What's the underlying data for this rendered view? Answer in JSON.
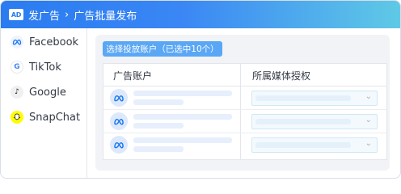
{
  "titlebar": {
    "badge": "AD",
    "crumb_root": "发广告",
    "separator": "›",
    "crumb_current": "广告批量发布"
  },
  "sidebar": {
    "items": [
      {
        "label": "Facebook",
        "icon": "facebook-icon"
      },
      {
        "label": "TikTok",
        "icon": "tiktok-icon"
      },
      {
        "label": "Google",
        "icon": "google-icon"
      },
      {
        "label": "SnapChat",
        "icon": "snapchat-icon"
      }
    ]
  },
  "main": {
    "select_button": "选择投放账户（已选中10个）",
    "table": {
      "headers": [
        "广告账户",
        "所属媒体授权"
      ],
      "rows": [
        {
          "account_icon": "meta-icon"
        },
        {
          "account_icon": "meta-icon"
        },
        {
          "account_icon": "meta-icon"
        }
      ]
    }
  },
  "colors": {
    "titlebar_start": "#2a7cf0",
    "titlebar_end": "#5fc9e6",
    "button": "#5aa7f5",
    "meta_blue": "#1877f2"
  }
}
